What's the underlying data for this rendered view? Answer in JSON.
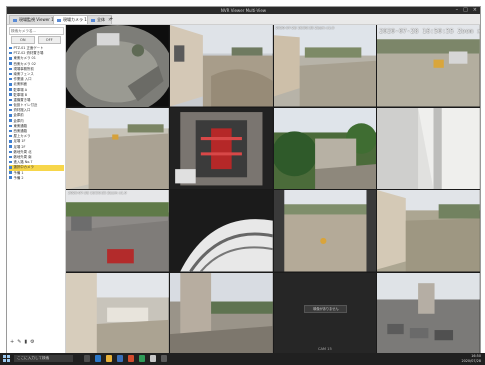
{
  "window": {
    "title": "NVR Viewer Multi-View"
  },
  "tabs": [
    {
      "label": "現場監視 Viewer 1",
      "close": "×"
    },
    {
      "label": "現場カメラ 1",
      "close": "×"
    },
    {
      "label": "全体",
      "close": "×"
    }
  ],
  "new_tab": "+",
  "sidebar": {
    "search_placeholder": "検索カメラ名...",
    "buttons": [
      "ON",
      "OFF"
    ],
    "tree": [
      "PTZ-01 正面ゲート",
      "PTZ-02 資材置き場",
      "東側カメラ 01",
      "西側カメラ 02",
      "現場事務所前",
      "南側フェンス",
      "作業道 入口",
      "北側斜面",
      "駐車場 A",
      "駐車場 B",
      "重機置き場",
      "仮設トイレ付近",
      "資材搬入口",
      "倉庫前",
      "倉庫内",
      "東側通路",
      "西側通路",
      "屋上カメラ",
      "足場 1F",
      "足場 2F",
      "敷地外周 北",
      "敷地外周 南",
      "進入路 No.7",
      "選択中カメラ",
      "予備 1",
      "予備 2"
    ],
    "selected_index": 23,
    "tools": [
      "+",
      "✎",
      "▮",
      "⚙"
    ]
  },
  "tiles": [
    {
      "osd": "",
      "big": false
    },
    {
      "osd": "",
      "big": false
    },
    {
      "osd": "2020-07-28 16:50:35 Zoom x1.0",
      "big": false
    },
    {
      "osd": "2020-07-28 16:50:35 Zoom x1.0",
      "big": true
    },
    {
      "osd": "",
      "big": false
    },
    {
      "osd": "",
      "big": false
    },
    {
      "osd": "",
      "big": false
    },
    {
      "osd": "",
      "big": false
    },
    {
      "osd": "2020-07-28 16:50:35 Zoom x1.0",
      "big": false
    },
    {
      "osd": "",
      "big": false
    },
    {
      "osd": "",
      "big": false
    },
    {
      "osd": "",
      "big": false
    },
    {
      "osd": "",
      "big": false
    },
    {
      "osd": "",
      "big": false
    },
    {
      "osd": "",
      "big": false,
      "label": "CAM 15",
      "button": "映像がありません"
    },
    {
      "osd": "",
      "big": false
    }
  ],
  "taskbar": {
    "search": "ここに入力して検索",
    "time": "16:50",
    "date": "2020/07/28"
  },
  "colors": {
    "selected": "#f7d64a",
    "camera_icon": "#3f7fd0",
    "taskbar": "#202020"
  }
}
